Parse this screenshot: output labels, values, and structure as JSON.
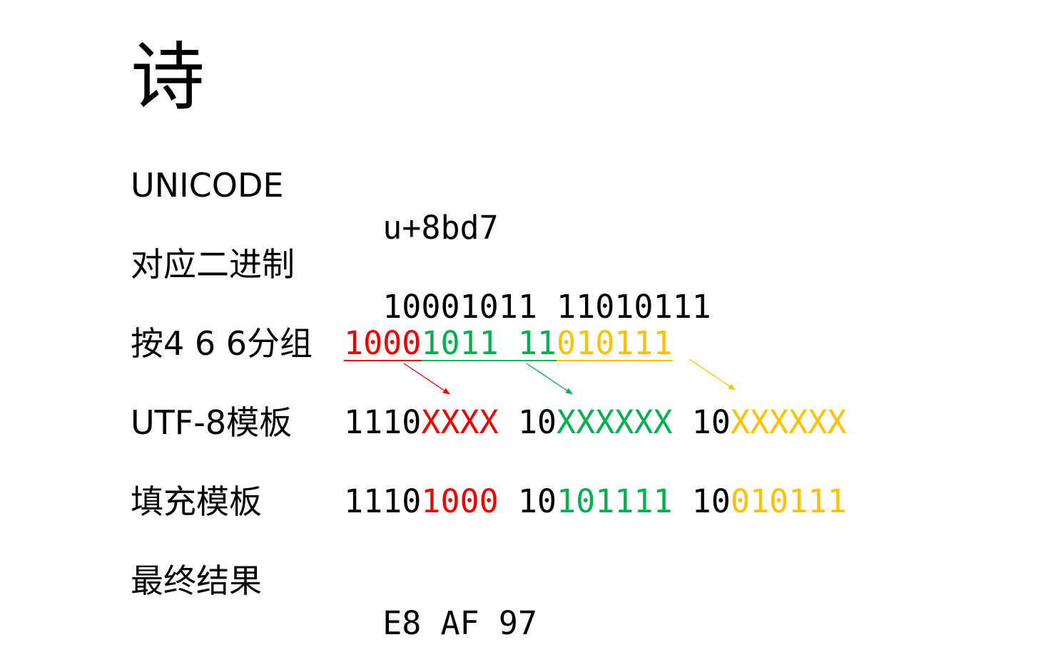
{
  "title_char": "诗",
  "colors": {
    "text": "#000000",
    "red": "#ee0000",
    "green": "#00b050",
    "yellow": "#ffc000"
  },
  "rows": [
    {
      "label": "UNICODE",
      "segments": [
        {
          "text": "u+8bd7",
          "color": "#000000"
        }
      ]
    },
    {
      "label": "对应二进制",
      "segments": [
        {
          "text": "10001011 11010111",
          "color": "#000000"
        }
      ]
    },
    {
      "label": "按4 6 6分组",
      "segments": [
        {
          "text": "1000",
          "color": "#ee0000"
        },
        {
          "text": "1011 11",
          "color": "#00b050"
        },
        {
          "text": "010111",
          "color": "#ffc000"
        }
      ]
    },
    {
      "label": "UTF-8模板",
      "segments": [
        {
          "text": "1110",
          "color": "#000000"
        },
        {
          "text": "XXXX",
          "color": "#ee0000"
        },
        {
          "text": " 10",
          "color": "#000000"
        },
        {
          "text": "XXXXXX",
          "color": "#00b050"
        },
        {
          "text": " 10",
          "color": "#000000"
        },
        {
          "text": "XXXXXX",
          "color": "#ffc000"
        }
      ]
    },
    {
      "label": "填充模板",
      "segments": [
        {
          "text": "1110",
          "color": "#000000"
        },
        {
          "text": "1000",
          "color": "#ee0000"
        },
        {
          "text": " 10",
          "color": "#000000"
        },
        {
          "text": "101111",
          "color": "#00b050"
        },
        {
          "text": " 10",
          "color": "#000000"
        },
        {
          "text": "010111",
          "color": "#ffc000"
        }
      ]
    },
    {
      "label": "最终结果",
      "segments": [
        {
          "text": "E8 AF 97",
          "color": "#000000"
        }
      ]
    }
  ],
  "arrows": [
    {
      "from": "grouped-red-segment",
      "to": "template-red-slot",
      "color": "#ee0000"
    },
    {
      "from": "grouped-green-segment",
      "to": "template-green-slot",
      "color": "#00b050"
    },
    {
      "from": "grouped-yellow-segment",
      "to": "template-yellow-slot",
      "color": "#ffc000"
    }
  ]
}
